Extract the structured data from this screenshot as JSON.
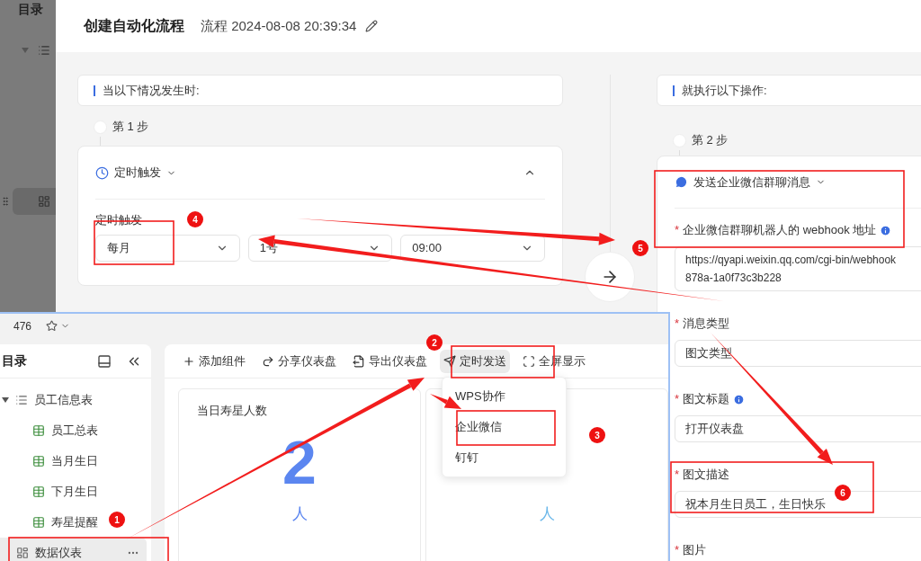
{
  "background_sidebar": {
    "title": "目录"
  },
  "dialog": {
    "title": "创建自动化流程",
    "subtitle": "流程 2024-08-08 20:39:34"
  },
  "trigger": {
    "heading": "当以下情况发生时:",
    "step": "第 1 步",
    "type": "定时触发",
    "expanded": true,
    "field_label": "定时触发",
    "selects": [
      "每月",
      "1号",
      "09:00"
    ]
  },
  "action": {
    "heading": "就执行以下操作:",
    "step": "第 2 步",
    "type": "发送企业微信群聊消息",
    "fields": [
      {
        "kind": "textarea",
        "label": "企业微信群聊机器人的 webhook 地址",
        "required": "*",
        "info": true,
        "lines": [
          "https://qyapi.weixin.qq.com/cgi-bin/webhook",
          "878a-1a0f73c3b228"
        ]
      },
      {
        "kind": "select",
        "label": "消息类型",
        "required": "*",
        "info": false,
        "value": "图文类型"
      },
      {
        "kind": "input",
        "label": "图文标题",
        "required": "*",
        "info": true,
        "value": "打开仪表盘"
      },
      {
        "kind": "input",
        "label": "图文描述",
        "required": "*",
        "info": false,
        "value": "祝本月生日员工，生日快乐"
      },
      {
        "kind": "label",
        "label": "图片",
        "required": "*",
        "info": false
      }
    ]
  },
  "dashboard_window": {
    "doc_title": "476",
    "sidebar": {
      "title": "目录",
      "tree": [
        {
          "kind": "list",
          "label": "员工信息表",
          "expanded": true,
          "selected": false,
          "children": [
            {
              "kind": "sheet",
              "label": "员工总表",
              "selected": false
            },
            {
              "kind": "sheet",
              "label": "当月生日",
              "selected": false
            },
            {
              "kind": "sheet",
              "label": "下月生日",
              "selected": false
            },
            {
              "kind": "sheet",
              "label": "寿星提醒",
              "selected": false
            }
          ]
        },
        {
          "kind": "dashboard",
          "label": "数据仪表",
          "selected": true
        }
      ]
    },
    "toolbar": [
      {
        "kind": "add",
        "label": "添加组件",
        "selected": false
      },
      {
        "kind": "share",
        "label": "分享仪表盘",
        "selected": false
      },
      {
        "kind": "export",
        "label": "导出仪表盘",
        "selected": false
      },
      {
        "kind": "send",
        "label": "定时发送",
        "selected": true
      },
      {
        "kind": "fullscreen",
        "label": "全屏显示",
        "selected": false
      }
    ],
    "send_menu": [
      "WPS协作",
      "企业微信",
      "钉钉"
    ],
    "cards": [
      {
        "title": "当日寿星人数",
        "value": "2",
        "unit": "人",
        "color": "#5b86f0"
      },
      {
        "unit": "人",
        "color": "#6cb8ea"
      }
    ]
  },
  "annotations": [
    "1",
    "2",
    "3",
    "4",
    "5",
    "6"
  ]
}
